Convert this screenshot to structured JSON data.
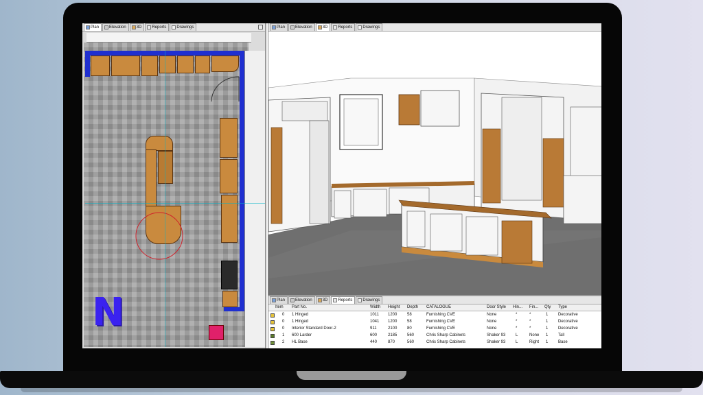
{
  "tabs": {
    "plan": "Plan",
    "elevation": "Elevation",
    "three_d": "3D",
    "reports": "Reports",
    "drawings": "Drawings"
  },
  "report": {
    "columns": [
      "Item",
      "Part No.",
      "Width",
      "Height",
      "Depth",
      "CATALOGUE",
      "Door Style",
      "Hin...",
      "Fin...",
      "Qty",
      "Type"
    ],
    "rows": [
      {
        "item": "0",
        "part": "1 Hinged",
        "width": "1011",
        "height": "1200",
        "depth": "58",
        "catalogue": "Furnishing CVE",
        "door": "None",
        "hin": "*",
        "fin": "*",
        "qty": "1",
        "type": "Decorative",
        "icon": "decorative-item-icon"
      },
      {
        "item": "0",
        "part": "1 Hinged",
        "width": "1041",
        "height": "1200",
        "depth": "58",
        "catalogue": "Furnishing CVE",
        "door": "None",
        "hin": "*",
        "fin": "*",
        "qty": "1",
        "type": "Decorative",
        "icon": "decorative-item-icon"
      },
      {
        "item": "0",
        "part": "Interior Standard Door-2",
        "width": "911",
        "height": "2100",
        "depth": "80",
        "catalogue": "Furnishing CVE",
        "door": "None",
        "hin": "*",
        "fin": "*",
        "qty": "1",
        "type": "Decorative",
        "icon": "decorative-item-icon"
      },
      {
        "item": "1",
        "part": "600 Larder",
        "width": "600",
        "height": "2185",
        "depth": "560",
        "catalogue": "Chris Sharp Cabinets",
        "door": "Shaker 93",
        "hin": "L",
        "fin": "None",
        "qty": "1",
        "type": "Tall",
        "icon": "tall-cabinet-icon"
      },
      {
        "item": "2",
        "part": "HL Base",
        "width": "440",
        "height": "870",
        "depth": "560",
        "catalogue": "Chris Sharp Cabinets",
        "door": "Shaker 93",
        "hin": "L",
        "fin": "Right",
        "qty": "1",
        "type": "Base",
        "icon": "base-cabinet-icon"
      }
    ]
  },
  "logo_letter": "N",
  "colors": {
    "wall": "#1f2fd0",
    "cabinet": "#c98a3e",
    "logo": "#3a22f0",
    "marker": "#e0206a"
  }
}
